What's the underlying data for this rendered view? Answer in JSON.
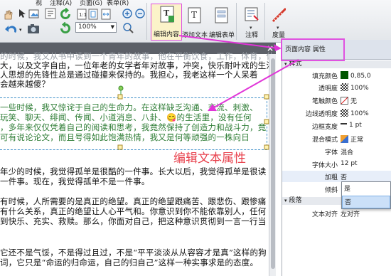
{
  "menu": {
    "frag1": "视",
    "frag2": "注释(A)",
    "frag3": "页面(G)",
    "frag4": "表单(R)"
  },
  "toolbar": {
    "zoom_value": "100%",
    "edit_content": "编辑内容",
    "add_text": "添加文本",
    "edit_form": "编辑表单",
    "annotate": "注释",
    "measure": "度量"
  },
  "document": {
    "lines": [
      "的时候，我又从书中读到一个青年的故事，他在平衡饮食，工作，体育，休闲，",
      "大，以及文字自由，一位年老的女学者年对故事，冲突，快乐耐叶戏的生活有天然的向往，也因为",
      "人思想的先锋性总是通过碰撞来保持的。我担心，我老这样一个人呆着",
      "会越来越傻？"
    ],
    "selected_lines": [
      "一些时候，我又惊诧于自己的生命力。在这样缺乏沟通、交流、刺激、",
      "玩笑、聊天、绯闻、传闻、小道消息、八卦、😋的生活里，没有任何",
      "，多年来仅仅凭着自己的阅读和思考，我竟然保持了创造力和战斗力，竟",
      "可有说论论文，而且号得如此饱满热情，我又是何等顽强的一株向日"
    ],
    "lines_after": [
      "年少的时候，我觉得孤单是很酷的一件事。长大以后，我觉得孤单是很读",
      "一件事。现在，我觉得孤单不是一件事。",
      "",
      "有时候，人所需要的是真正的绝望。真正的绝望跟痛苦、跟悲伤、跟惨痛",
      "有什么关系，真正的绝望让人心平气和。你意识到你不能依靠别人，任何",
      "到快乐、充实、救赎。那么，你面对自己，把这种意识贯彻到一言一行当",
      "",
      "它还不是气馁，不是得过且过，不是“平平淡淡从从容容才是真”这样的狗",
      "词，它只是“命运的归命运，自己的归自己”这样一种实事求是的态度。"
    ],
    "callout": "编辑文本属性"
  },
  "panel": {
    "title": "页面内容 属性",
    "group_style": "样式",
    "group_paragraph": "段落",
    "rows": [
      {
        "label": "填充颜色",
        "value": "0,85,0",
        "swatch": "solid"
      },
      {
        "label": "透明度",
        "value": "100%",
        "swatch": "checker"
      },
      {
        "label": "笔触颜色",
        "value": "无",
        "swatch": "none"
      },
      {
        "label": "边线透明度",
        "value": "100%",
        "swatch": "checker"
      },
      {
        "label": "边框宽度",
        "value": "1 pt",
        "swatch": "line"
      },
      {
        "label": "混合模式",
        "value": "正常",
        "swatch": "orange"
      },
      {
        "label": "字体",
        "value": "混合",
        "swatch": ""
      },
      {
        "label": "字体大小",
        "value": "12 pt",
        "swatch": ""
      },
      {
        "label": "加粗",
        "value": "否",
        "swatch": ""
      },
      {
        "label": "倾斜",
        "value": "",
        "swatch": ""
      }
    ],
    "align_label": "文本对齐",
    "align_value": "左对齐",
    "dropdown_options": [
      "是",
      "否"
    ]
  },
  "colors": {
    "fill": "#005500",
    "highlight_frame": "#e052e0",
    "arrow": "#e035d8",
    "callout": "#e8424d",
    "selection": "#3f8fc9"
  }
}
